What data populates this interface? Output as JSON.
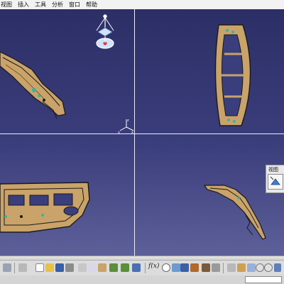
{
  "menubar": {
    "items": [
      {
        "label": "视图",
        "id": "view"
      },
      {
        "label": "插入",
        "id": "insert"
      },
      {
        "label": "工具",
        "id": "tools"
      },
      {
        "label": "分析",
        "id": "analysis"
      },
      {
        "label": "窗口",
        "id": "window"
      },
      {
        "label": "帮助",
        "id": "help"
      }
    ]
  },
  "viewport": {
    "background_top": "#2c2f66",
    "background_bottom": "#5d6099",
    "divider_color": "#ececf4",
    "part_color": "#c9a36a",
    "part_outline": "#1a1a1a",
    "part_accent": "#2fb6a8",
    "panes": [
      "top-left",
      "top-right",
      "bottom-left",
      "bottom-right"
    ]
  },
  "compass": {
    "icon": "compass-icon",
    "accent": "#d42020",
    "fill": "#cfe2ff"
  },
  "axis_triad": {
    "icon": "axis-triad-icon",
    "labels": {
      "x": "x",
      "y": "y",
      "z": "z"
    }
  },
  "views_panel": {
    "title": "视图",
    "button_icon": "view-fit-icon"
  },
  "toolbar": {
    "formula_label": "f(x)",
    "icons": [
      "select-arrow-icon",
      "snap-icon",
      "new-file-icon",
      "open-folder-icon",
      "save-icon",
      "print-icon",
      "cut-icon",
      "copy-icon",
      "paste-icon",
      "undo-icon",
      "redo-icon",
      "whats-this-icon",
      "formula-icon",
      "comment-icon",
      "search-icon",
      "table-icon",
      "measure-icon",
      "analysis-icon",
      "settings-icon",
      "fly-icon",
      "pan-icon",
      "rotate-icon",
      "zoom-in-icon",
      "zoom-out-icon",
      "normal-view-icon",
      "multi-view-icon",
      "iso-view-icon"
    ]
  },
  "statusbar": {
    "field_value": ""
  }
}
